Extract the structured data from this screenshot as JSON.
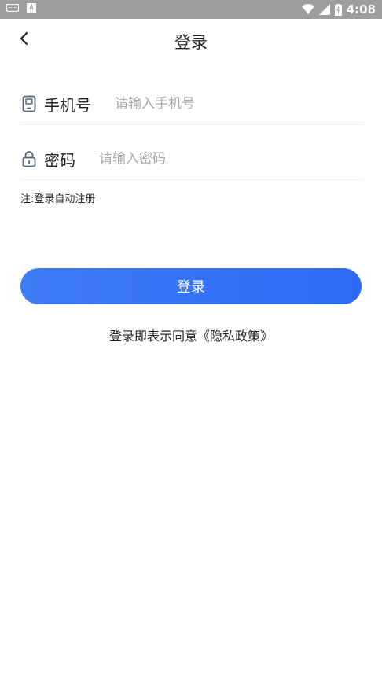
{
  "status_bar": {
    "time": "4:08",
    "a_badge": "A"
  },
  "nav": {
    "title": "登录",
    "back_icon": "chevron-left-icon"
  },
  "form": {
    "phone": {
      "label": "手机号",
      "placeholder": "请输入手机号",
      "value": "",
      "icon": "phone-icon"
    },
    "password": {
      "label": "密码",
      "placeholder": "请输入密码",
      "value": "",
      "icon": "lock-icon"
    },
    "note": "注:登录自动注册"
  },
  "login_button": {
    "label": "登录",
    "color": "#3a76f6"
  },
  "agreement": {
    "prefix": "登录即表示同意",
    "link": "《隐私政策》"
  }
}
